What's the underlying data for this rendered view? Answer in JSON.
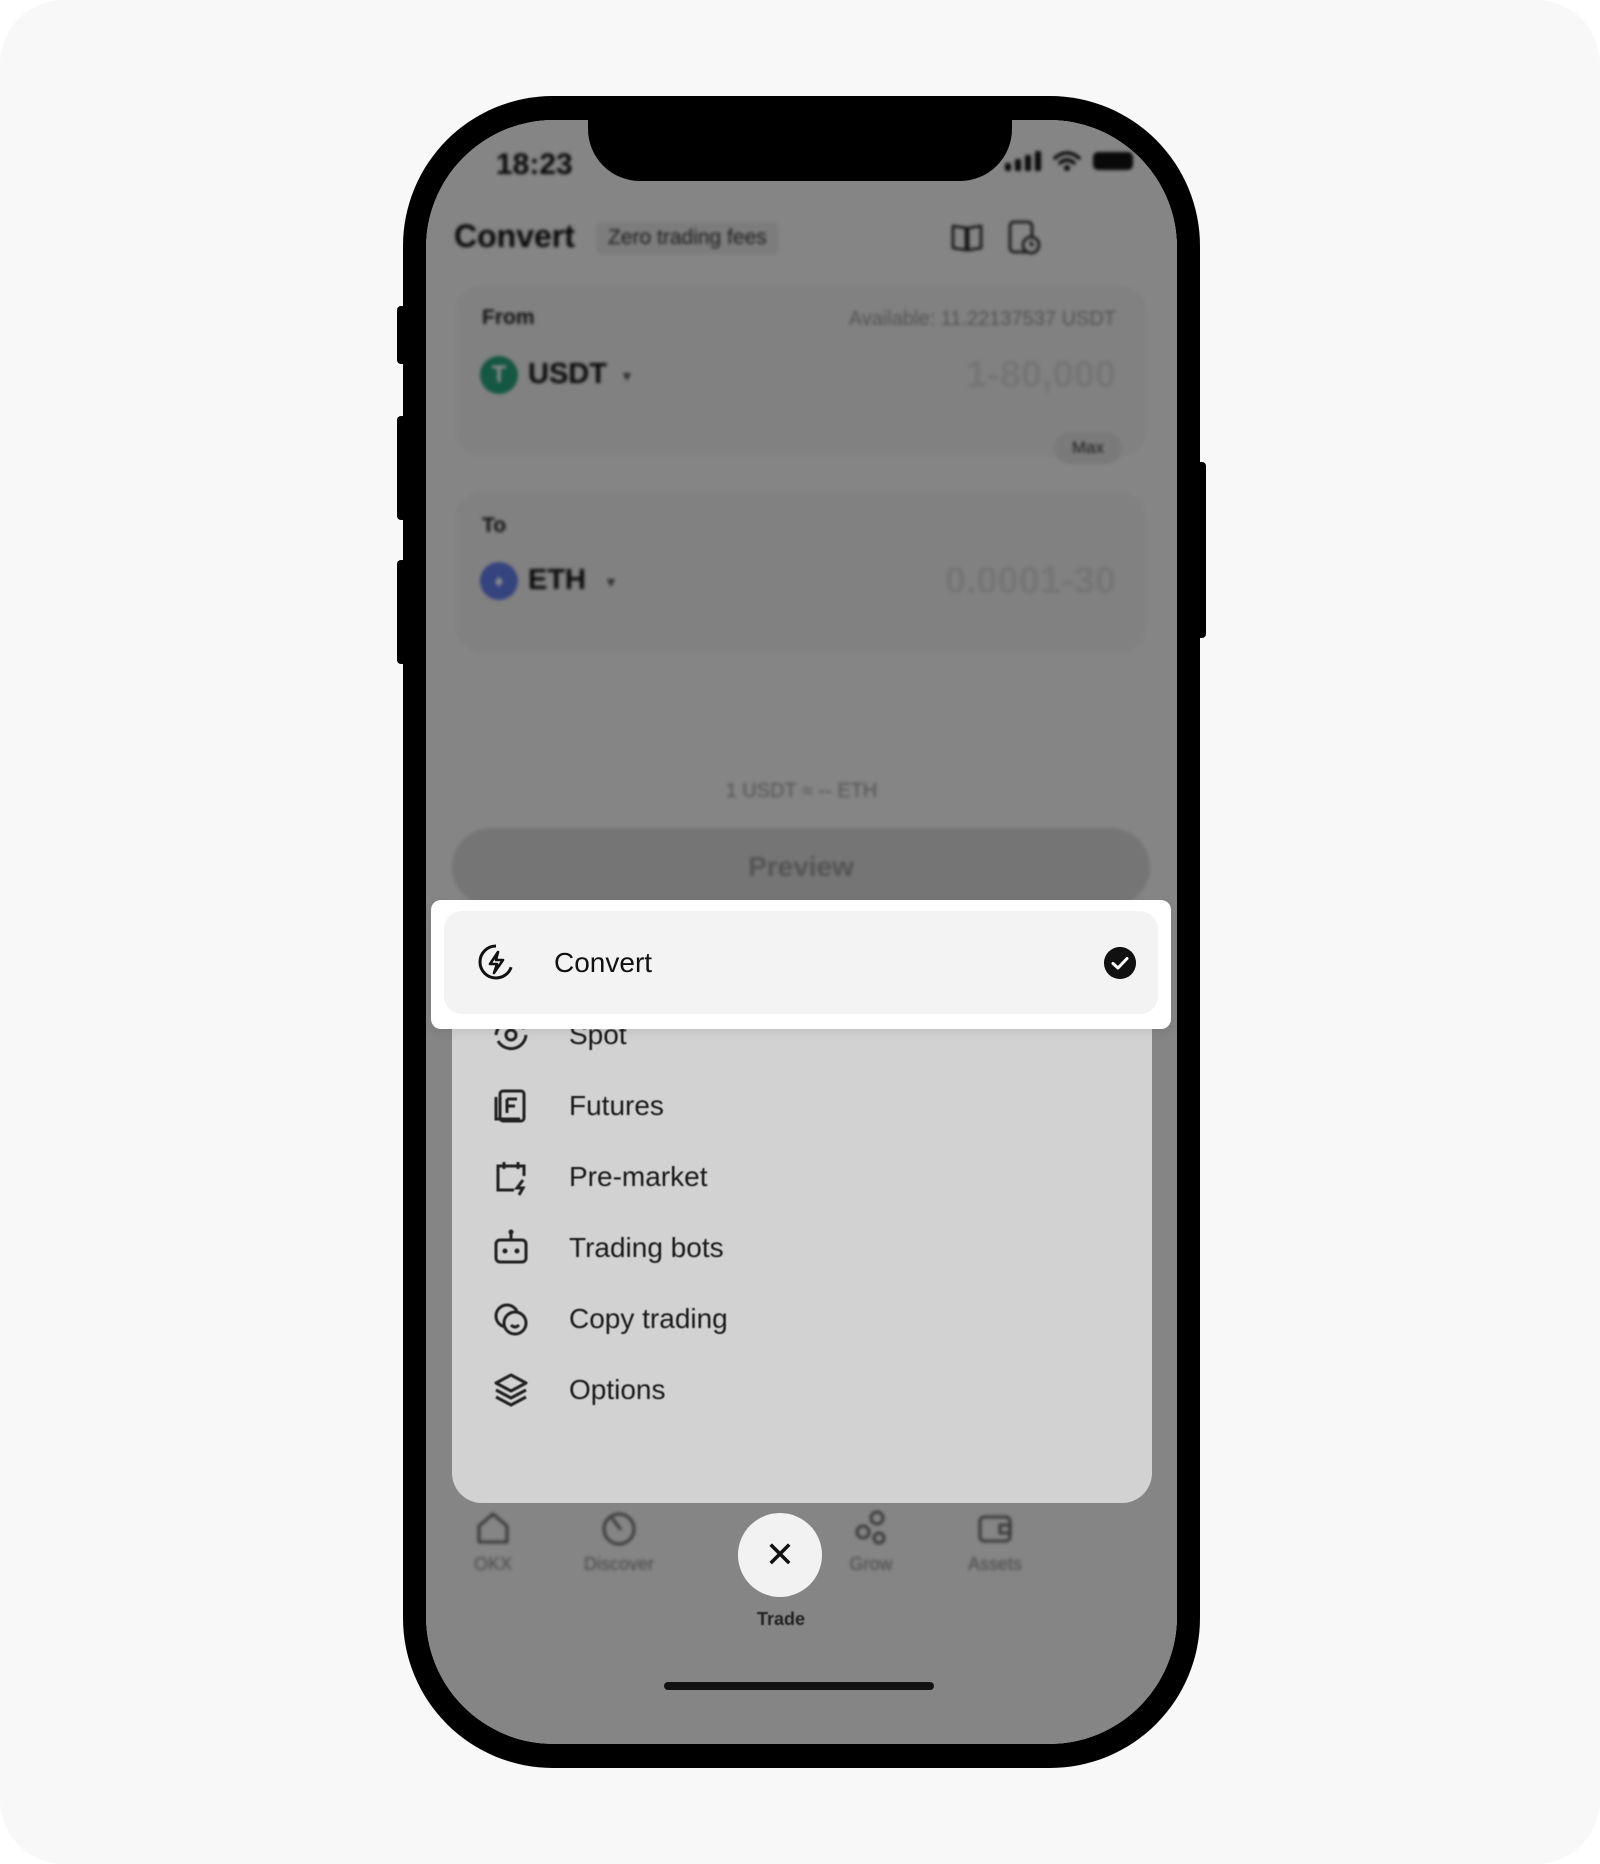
{
  "status_bar": {
    "time": "18:23"
  },
  "header": {
    "title": "Convert",
    "tag": "Zero trading fees"
  },
  "from_panel": {
    "label": "From",
    "available": "Available: 11.22137537 USDT",
    "coin": "USDT",
    "coin_letter": "T",
    "range_placeholder": "1-80,000",
    "max_label": "Max"
  },
  "to_panel": {
    "label": "To",
    "coin": "ETH",
    "coin_letter": "♦",
    "range_placeholder": "0.0001-30"
  },
  "rate": "1 USDT ≈ -- ETH",
  "preview_label": "Preview",
  "menu": {
    "selected": {
      "label": "Convert",
      "icon": "convert-icon"
    },
    "items": [
      {
        "label": "Spot",
        "icon": "spot-icon"
      },
      {
        "label": "Futures",
        "icon": "futures-icon"
      },
      {
        "label": "Pre-market",
        "icon": "pre-market-icon"
      },
      {
        "label": "Trading bots",
        "icon": "trading-bots-icon"
      },
      {
        "label": "Copy trading",
        "icon": "copy-trading-icon"
      },
      {
        "label": "Options",
        "icon": "options-icon"
      }
    ]
  },
  "tab_bar": {
    "tabs": [
      {
        "label": "OKX",
        "icon": "home-icon"
      },
      {
        "label": "Discover",
        "icon": "discover-icon"
      },
      {
        "label": "Trade",
        "icon": "close-icon"
      },
      {
        "label": "Grow",
        "icon": "grow-icon"
      },
      {
        "label": "Assets",
        "icon": "wallet-icon"
      }
    ]
  },
  "colors": {
    "usdt": "#26a17b",
    "eth": "#627eea",
    "overlay": "#000000"
  }
}
